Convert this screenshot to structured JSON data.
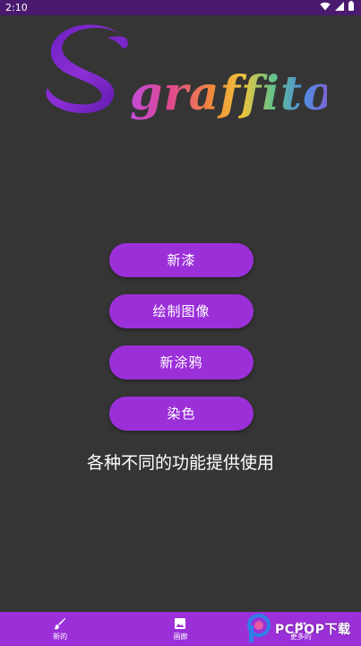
{
  "status_bar": {
    "time": "2:10",
    "icons": [
      "wifi-icon",
      "signal-icon",
      "battery-icon"
    ]
  },
  "logo": {
    "text": "Sgraffito"
  },
  "menu": {
    "items": [
      {
        "label": "新漆"
      },
      {
        "label": "绘制图像"
      },
      {
        "label": "新涂鸦"
      },
      {
        "label": "染色"
      }
    ]
  },
  "tagline": "各种不同的功能提供使用",
  "bottom_nav": {
    "items": [
      {
        "label": "新的",
        "icon": "brush-icon"
      },
      {
        "label": "画廊",
        "icon": "image-icon"
      },
      {
        "label": "更多的",
        "icon": "more-icon"
      }
    ]
  },
  "watermark": {
    "text": "PCPOP下载"
  },
  "colors": {
    "accent": "#9b30d9",
    "status_bar": "#4a1a6e",
    "background": "#353535"
  }
}
